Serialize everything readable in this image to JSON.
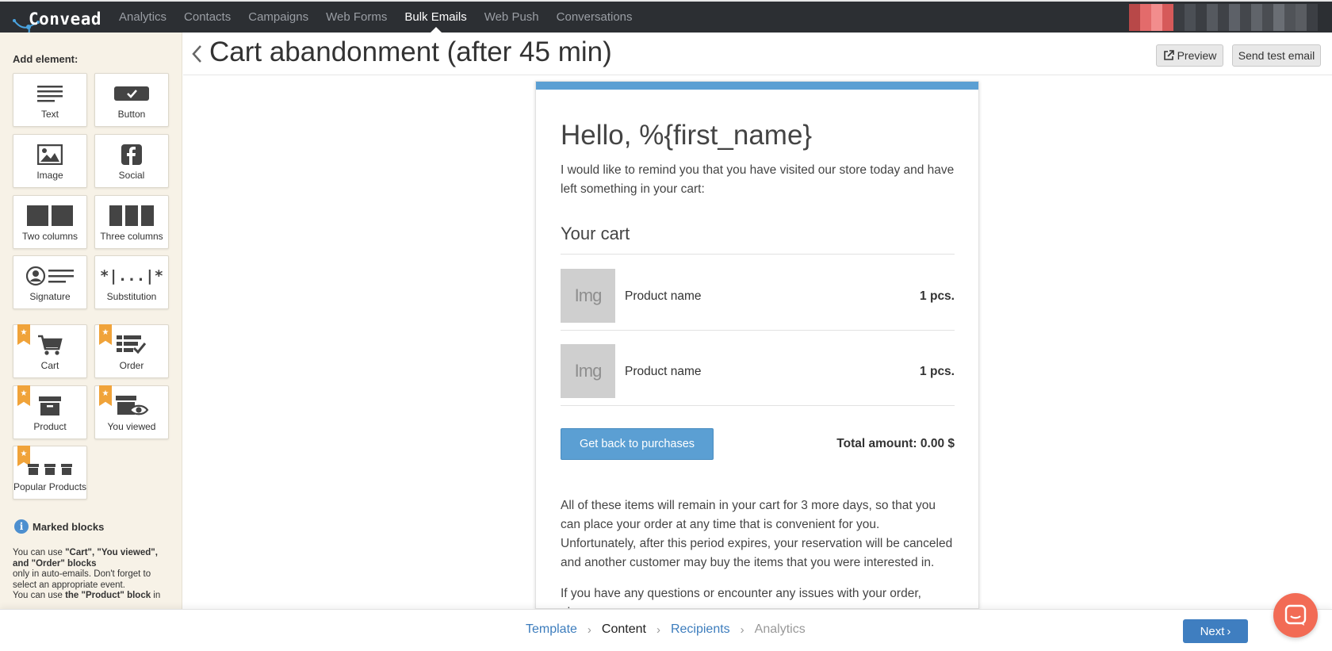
{
  "brand": {
    "name": "Convead"
  },
  "nav": {
    "items": [
      {
        "label": "Analytics"
      },
      {
        "label": "Contacts"
      },
      {
        "label": "Campaigns"
      },
      {
        "label": "Web Forms"
      },
      {
        "label": "Bulk Emails",
        "active": true
      },
      {
        "label": "Web Push"
      },
      {
        "label": "Conversations"
      }
    ]
  },
  "sidebar": {
    "title": "Add element:",
    "elements": [
      {
        "label": "Text",
        "icon": "text-icon"
      },
      {
        "label": "Button",
        "icon": "button-icon"
      },
      {
        "label": "Image",
        "icon": "image-icon"
      },
      {
        "label": "Social",
        "icon": "facebook-icon"
      },
      {
        "label": "Two columns",
        "icon": "two-columns-icon"
      },
      {
        "label": "Three columns",
        "icon": "three-columns-icon"
      },
      {
        "label": "Signature",
        "icon": "signature-icon"
      },
      {
        "label": "Substitution",
        "icon": "substitution-icon",
        "icon_text": "*|...|*"
      },
      {
        "label": "Cart",
        "icon": "cart-icon",
        "marked": true
      },
      {
        "label": "Order",
        "icon": "order-icon",
        "marked": true
      },
      {
        "label": "Product",
        "icon": "product-box-icon",
        "marked": true
      },
      {
        "label": "You viewed",
        "icon": "viewed-icon",
        "marked": true
      },
      {
        "label": "Popular Products",
        "icon": "popular-products-icon",
        "marked": true
      }
    ],
    "marked_blocks": {
      "title": "Marked blocks",
      "note1_prefix": "You can use ",
      "note1_bold": "\"Cart\", \"You viewed\", and \"Order\" blocks",
      "note1_suffix": "only in auto-emails. Don't forget to select an appropriate event.",
      "note2_prefix": "You can use ",
      "note2_bold": "the \"Product\" block",
      "note2_suffix": " in"
    }
  },
  "header": {
    "title": "Cart abandonment (after 45 min)",
    "preview_label": "Preview",
    "send_test_label": "Send test email"
  },
  "email": {
    "greeting": "Hello, %{first_name}",
    "intro": "I would like to remind you that you have visited our store today and have left something in your cart:",
    "cart_title": "Your cart",
    "products": [
      {
        "img_text": "Img",
        "name": "Product name",
        "qty": "1 pcs."
      },
      {
        "img_text": "Img",
        "name": "Product name",
        "qty": "1 pcs."
      }
    ],
    "cta_label": "Get back to purchases",
    "total": "Total amount: 0.00 $",
    "body1": "All of these items will remain in your cart for 3 more days, so that you can place your order at any time that is convenient for you. Unfortunately, after this period expires, your reservation will be canceled and another customer may buy the items that you were interested in.",
    "body2": "If you have any questions or encounter any issues with your order, please"
  },
  "wizard": {
    "steps": [
      {
        "label": "Template",
        "state": "link"
      },
      {
        "label": "Content",
        "state": "current"
      },
      {
        "label": "Recipients",
        "state": "link"
      },
      {
        "label": "Analytics",
        "state": "disabled"
      }
    ],
    "next_label": "Next"
  },
  "colors": {
    "nav_bg": "#2c2f33",
    "accent_blue": "#5b9fd3",
    "ribbon_orange": "#f0a33a",
    "chat_red": "#f26b55"
  }
}
